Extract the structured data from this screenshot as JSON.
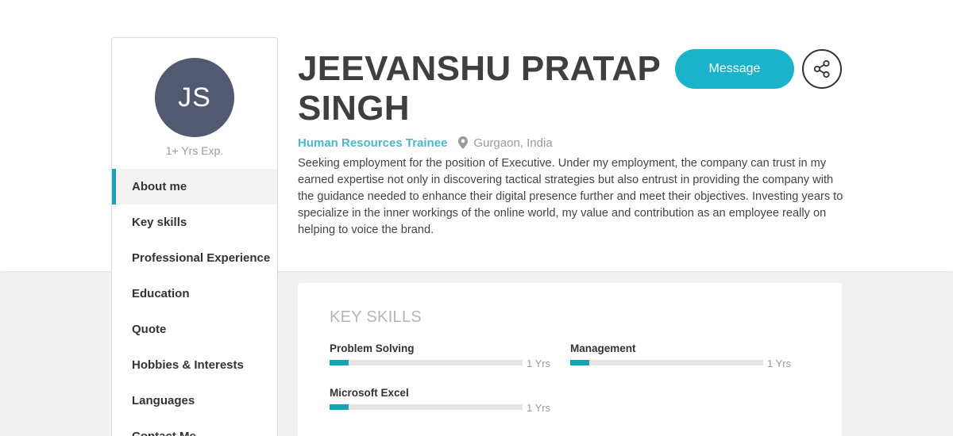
{
  "profile": {
    "initials": "JS",
    "experience": "1+ Yrs Exp.",
    "name": "JEEVANSHU PRATAP SINGH",
    "role": "Human Resources Trainee",
    "location": "Gurgaon, India",
    "bio": "Seeking employment for the position of Executive. Under my employment, the company can trust in my earned expertise not only in discovering tactical strategies but also entrust in providing the company with the guidance needed to enhance their digital presence further and meet their objectives. Investing years to specialize in the inner workings of the online world, my value and contribution as an employee really on helping to voice the brand."
  },
  "actions": {
    "message_label": "Message",
    "share_icon": "share-icon"
  },
  "nav": {
    "items": [
      {
        "label": "About me",
        "active": true
      },
      {
        "label": "Key skills"
      },
      {
        "label": "Professional Experience"
      },
      {
        "label": "Education"
      },
      {
        "label": "Quote"
      },
      {
        "label": "Hobbies & Interests"
      },
      {
        "label": "Languages"
      },
      {
        "label": "Contact Me"
      }
    ]
  },
  "skills": {
    "title": "KEY SKILLS",
    "items": [
      {
        "name": "Problem Solving",
        "years": "1 Yrs",
        "level": 0.1
      },
      {
        "name": "Management",
        "years": "1 Yrs",
        "level": 0.1
      },
      {
        "name": "Microsoft Excel",
        "years": "1 Yrs",
        "level": 0.1
      }
    ]
  },
  "colors": {
    "accent": "#1ab3c9",
    "avatar_bg": "#525a72",
    "bar_fill": "#1a9fb5"
  }
}
